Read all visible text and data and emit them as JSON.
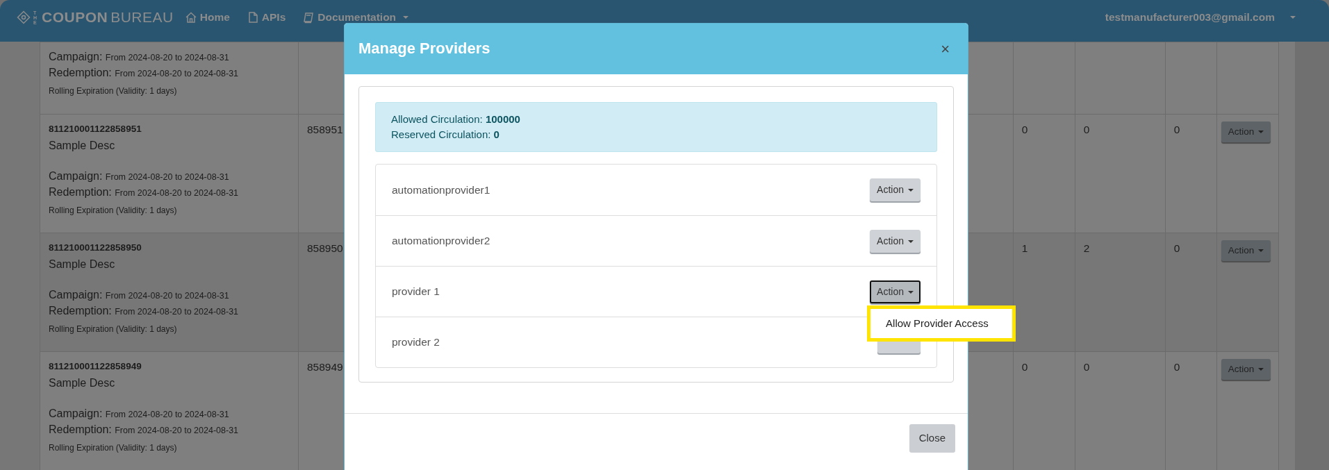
{
  "navbar": {
    "brand_prefix": "THE",
    "brand_bold": "COUPON",
    "brand_light": "BUREAU",
    "links": [
      {
        "label": "Home",
        "dropdown": false
      },
      {
        "label": "APIs",
        "dropdown": false
      },
      {
        "label": "Documentation",
        "dropdown": true
      }
    ],
    "user": "testmanufacturer003@gmail.com"
  },
  "table": {
    "rows": [
      {
        "campaign_label": "Campaign:",
        "campaign": "From 2024-08-20 to 2024-08-31",
        "redemption_label": "Redemption:",
        "redemption": "From 2024-08-20 to 2024-08-31",
        "rolling": "Rolling Expiration (Validity: 1 days)"
      },
      {
        "code": "811210001122858951",
        "description": "Sample Desc",
        "campaign_label": "Campaign:",
        "campaign": "From 2024-08-20 to 2024-08-31",
        "redemption_label": "Redemption:",
        "redemption": "From 2024-08-20 to 2024-08-31",
        "rolling": "Rolling Expiration (Validity: 1 days)",
        "id": "858951",
        "counts": [
          "0",
          "0",
          "0"
        ],
        "action": "Action"
      },
      {
        "code": "811210001122858950",
        "description": "Sample Desc",
        "campaign_label": "Campaign:",
        "campaign": "From 2024-08-20 to 2024-08-31",
        "redemption_label": "Redemption:",
        "redemption": "From 2024-08-20 to 2024-08-31",
        "rolling": "Rolling Expiration (Validity: 1 days)",
        "id": "858950",
        "counts": [
          "1",
          "2",
          "0"
        ],
        "action": "Action"
      },
      {
        "code": "811210001122858949",
        "description": "Sample Desc",
        "campaign_label": "Campaign:",
        "campaign": "From 2024-08-20 to 2024-08-31",
        "redemption_label": "Redemption:",
        "redemption": "From 2024-08-20 to 2024-08-31",
        "rolling": "Rolling Expiration (Validity: 1 days)",
        "id": "858949",
        "counts": [
          "0",
          "0",
          "0"
        ],
        "action": "Action"
      }
    ]
  },
  "modal": {
    "title": "Manage Providers",
    "close_icon": "×",
    "circulation": [
      {
        "label": "Allowed Circulation:",
        "value": "100000"
      },
      {
        "label": "Reserved Circulation:",
        "value": "0"
      }
    ],
    "providers": [
      {
        "name": "automationprovider1",
        "action": "Action",
        "expanded": false
      },
      {
        "name": "automationprovider2",
        "action": "Action",
        "expanded": false
      },
      {
        "name": "provider 1",
        "action": "Action",
        "expanded": true,
        "menu": [
          {
            "label": "Allow Provider Access",
            "highlighted": true
          }
        ]
      },
      {
        "name": "provider 2",
        "expanded": false
      }
    ],
    "footer_button": "Close"
  }
}
